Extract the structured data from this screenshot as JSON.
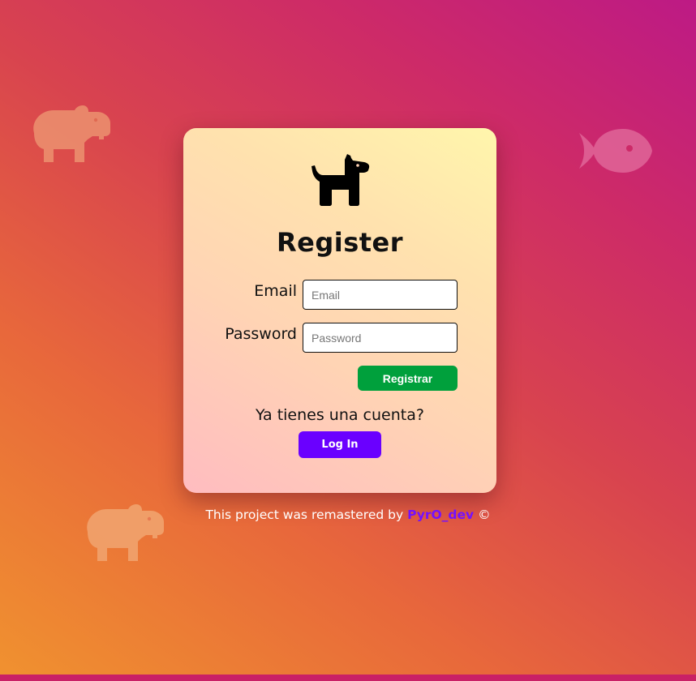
{
  "colors": {
    "card_gradient_start": "#ffbcc0",
    "card_gradient_end": "#fff6ac",
    "register_button": "#00a03c",
    "login_button": "#6a00ff",
    "author_link": "#7410ff"
  },
  "icons": {
    "logo": "dog-icon",
    "decorations": [
      "hippo-icon",
      "fish-icon",
      "hippo-icon"
    ]
  },
  "form": {
    "title": "Register",
    "email_label": "Email",
    "email_placeholder": "Email",
    "email_value": "",
    "password_label": "Password",
    "password_placeholder": "Password",
    "password_value": "",
    "submit_label": "Registrar"
  },
  "login": {
    "prompt": "Ya tienes una cuenta?",
    "button_label": "Log In"
  },
  "footer": {
    "text": "This project was remastered by",
    "author": "PyrO_dev",
    "copyright": "©"
  }
}
